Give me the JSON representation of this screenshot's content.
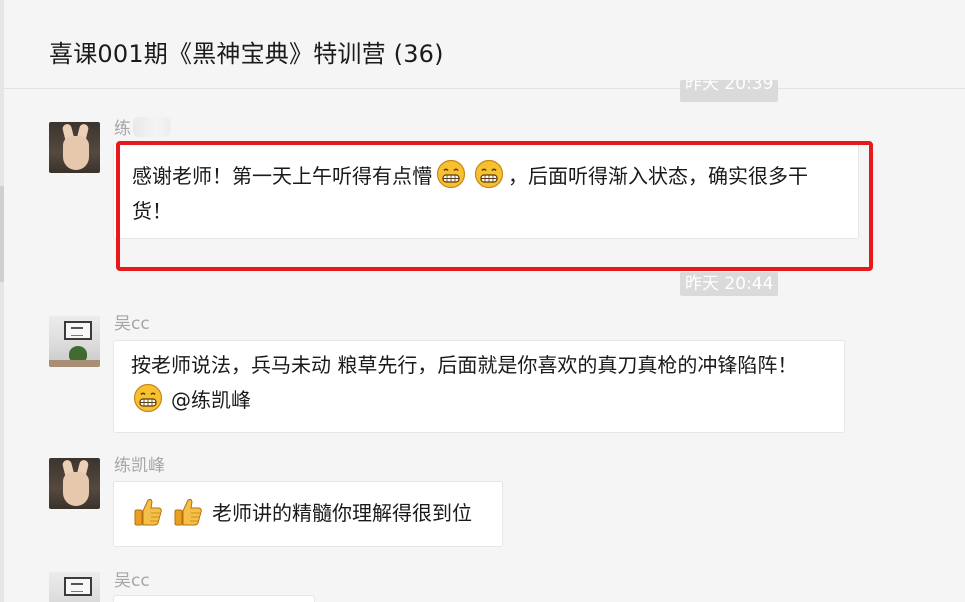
{
  "chat": {
    "title": "喜课001期《黑神宝典》特训营 (36)"
  },
  "timestamps": {
    "first": "昨天 20:39",
    "second": "昨天 20:44"
  },
  "messages": [
    {
      "sender": "练",
      "avatar": "hand-avatar",
      "text_before": "感谢老师！第一天上午听得有点懵",
      "emojis": [
        "grin-emoji",
        "grin-emoji"
      ],
      "text_after": "，后面听得渐入状态，确实很多干货！",
      "highlighted": true,
      "highlight_color": "#e8191b"
    },
    {
      "sender": "吴cc",
      "avatar": "room-avatar",
      "text": "按老师说法，兵马未动 粮草先行，后面就是你喜欢的真刀真枪的冲锋陷阵！",
      "emojis": [
        "grin-emoji"
      ],
      "mention": "@练凯峰"
    },
    {
      "sender": "练凯峰",
      "avatar": "hand-avatar",
      "emojis": [
        "thumbs-up-emoji",
        "thumbs-up-emoji"
      ],
      "text": "老师讲的精髓你理解得很到位"
    },
    {
      "sender": "吴cc",
      "avatar": "room-avatar"
    }
  ],
  "colors": {
    "background": "#f5f5f5",
    "bubble": "#ffffff",
    "sender_name": "#a6a6a6",
    "timestamp_bg": "#dadada"
  }
}
